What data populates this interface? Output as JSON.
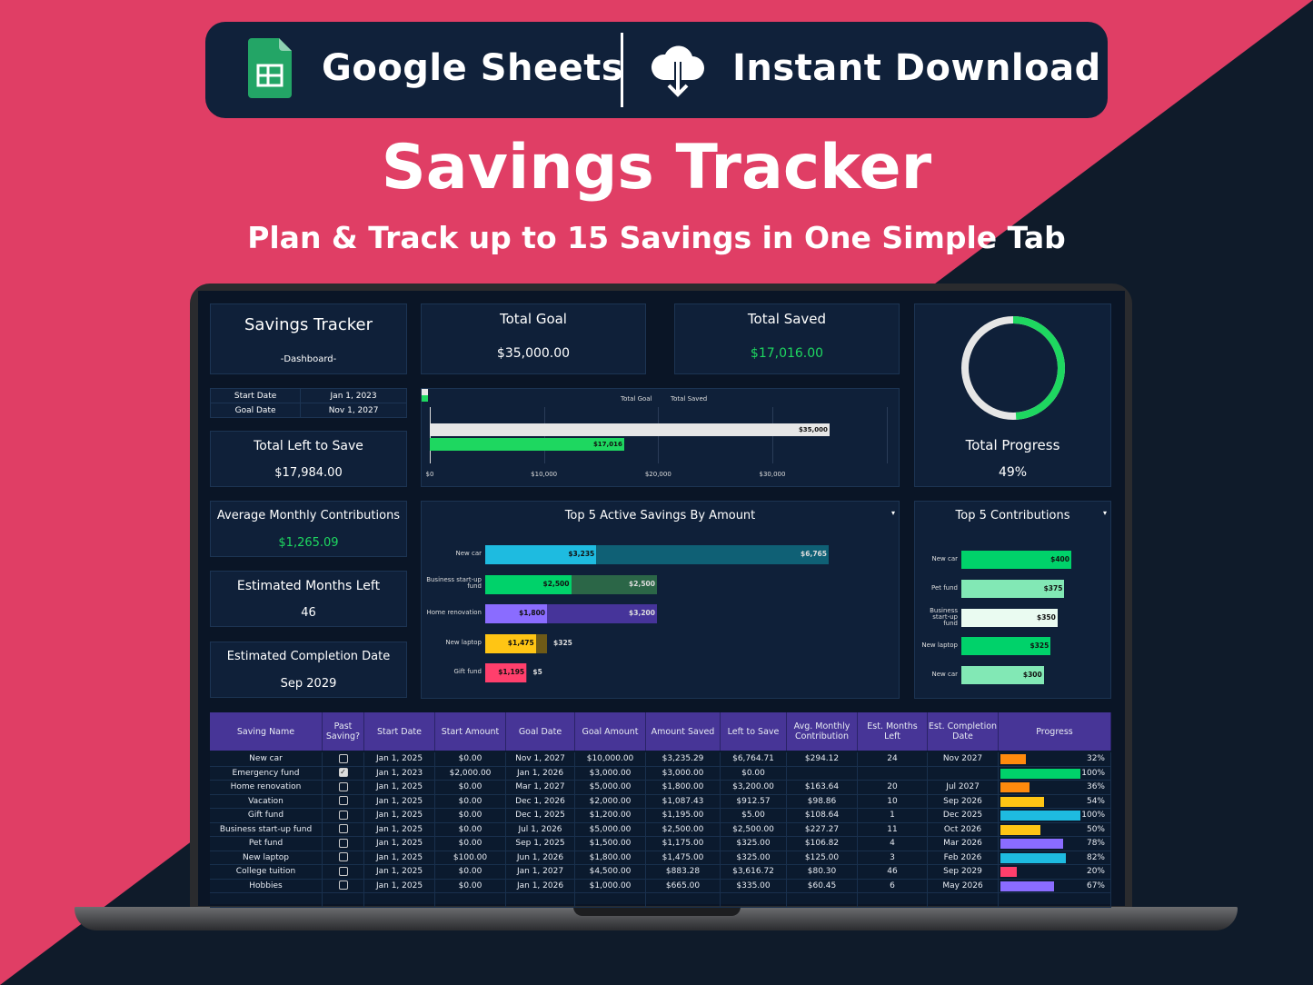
{
  "banner": {
    "app": "Google Sheets",
    "download": "Instant Download",
    "title": "Savings Tracker",
    "subtitle": "Plan & Track up to 15 Savings in One Simple Tab"
  },
  "colors": {
    "pink": "#e03e65",
    "navy": "#0f1b2a",
    "panel": "#0f2039",
    "header": "#473597",
    "green": "#1ed760"
  },
  "dashboard": {
    "title": "Savings Tracker",
    "subtitle": "-Dashboard-",
    "total_goal_label": "Total Goal",
    "total_goal": "$35,000.00",
    "total_saved_label": "Total Saved",
    "total_saved": "$17,016.00",
    "total_progress_label": "Total Progress",
    "total_progress": "49%",
    "progress_value": 0.49,
    "start_date_label": "Start Date",
    "start_date": "Jan 1, 2023",
    "goal_date_label": "Goal Date",
    "goal_date": "Nov 1, 2027",
    "left_label": "Total Left to Save",
    "left": "$17,984.00",
    "avg_label": "Average Monthly Contributions",
    "avg": "$1,265.09",
    "months_label": "Estimated Months Left",
    "months": "46",
    "completion_label": "Estimated Completion Date",
    "completion": "Sep 2029"
  },
  "chart_data": [
    {
      "type": "bar",
      "orientation": "horizontal",
      "legend": [
        "Total Goal",
        "Total Saved"
      ],
      "legend_position": "top",
      "series": [
        {
          "name": "Total Goal",
          "value": 35000,
          "label": "$35,000",
          "color": "#e6e6e6"
        },
        {
          "name": "Total Saved",
          "value": 17016,
          "label": "$17,016",
          "color": "#1ed760"
        }
      ],
      "x_ticks": [
        "$0",
        "$10,000",
        "$20,000",
        "$30,000"
      ],
      "xlim": [
        0,
        40000
      ]
    },
    {
      "type": "bar",
      "stacked": true,
      "orientation": "horizontal",
      "title": "Top 5 Active Savings By Amount",
      "categories": [
        "New car",
        "Business start-up fund",
        "Home renovation",
        "New laptop",
        "Gift fund"
      ],
      "saved": [
        3235,
        2500,
        1800,
        1475,
        1195
      ],
      "left": [
        6765,
        2500,
        3200,
        325,
        5
      ],
      "saved_labels": [
        "$3,235",
        "$2,500",
        "$1,800",
        "$1,475",
        "$1,195"
      ],
      "left_labels": [
        "$6,765",
        "$2,500",
        "$3,200",
        "$325",
        "$5"
      ],
      "colors": [
        "#1ebbe0",
        "#00d26a",
        "#8a6cff",
        "#ffc514",
        "#ff3f6c"
      ],
      "left_colors": [
        "#0f6075",
        "#2b6647",
        "#46349a",
        "#6e5a17",
        "#ff3f6c"
      ]
    },
    {
      "type": "bar",
      "orientation": "horizontal",
      "title": "Top 5 Contributions",
      "categories": [
        "New car",
        "Pet fund",
        "Business start-up fund",
        "New laptop",
        "New car"
      ],
      "values": [
        400,
        375,
        350,
        325,
        300
      ],
      "labels": [
        "$400",
        "$375",
        "$350",
        "$325",
        "$300"
      ],
      "colors": [
        "#00d26a",
        "#82e8b5",
        "#eafbf1",
        "#00d26a",
        "#82e8b5"
      ]
    }
  ],
  "table": {
    "headers": [
      "Saving Name",
      "Past Saving?",
      "Start Date",
      "Start Amount",
      "Goal Date",
      "Goal Amount",
      "Amount Saved",
      "Left to Save",
      "Avg. Monthly Contribution",
      "Est. Months Left",
      "Est. Completion Date",
      "Progress"
    ],
    "rows": [
      [
        "New car",
        false,
        "Jan 1, 2025",
        "$0.00",
        "Nov 1, 2027",
        "$10,000.00",
        "$3,235.29",
        "$6,764.71",
        "$294.12",
        "24",
        "Nov 2027",
        "32%",
        0.32,
        "#ff8a0d"
      ],
      [
        "Emergency fund",
        true,
        "Jan 1, 2023",
        "$2,000.00",
        "Jan 1, 2026",
        "$3,000.00",
        "$3,000.00",
        "$0.00",
        "",
        "",
        "",
        "100%",
        1,
        "#00d26a"
      ],
      [
        "Home renovation",
        false,
        "Jan 1, 2025",
        "$0.00",
        "Mar 1, 2027",
        "$5,000.00",
        "$1,800.00",
        "$3,200.00",
        "$163.64",
        "20",
        "Jul 2027",
        "36%",
        0.36,
        "#ff8a0d"
      ],
      [
        "Vacation",
        false,
        "Jan 1, 2025",
        "$0.00",
        "Dec 1, 2026",
        "$2,000.00",
        "$1,087.43",
        "$912.57",
        "$98.86",
        "10",
        "Sep 2026",
        "54%",
        0.54,
        "#ffc514"
      ],
      [
        "Gift fund",
        false,
        "Jan 1, 2025",
        "$0.00",
        "Dec 1, 2025",
        "$1,200.00",
        "$1,195.00",
        "$5.00",
        "$108.64",
        "1",
        "Dec 2025",
        "100%",
        1,
        "#1ebbe0"
      ],
      [
        "Business start-up fund",
        false,
        "Jan 1, 2025",
        "$0.00",
        "Jul 1, 2026",
        "$5,000.00",
        "$2,500.00",
        "$2,500.00",
        "$227.27",
        "11",
        "Oct 2026",
        "50%",
        0.5,
        "#ffc514"
      ],
      [
        "Pet fund",
        false,
        "Jan 1, 2025",
        "$0.00",
        "Sep 1, 2025",
        "$1,500.00",
        "$1,175.00",
        "$325.00",
        "$106.82",
        "4",
        "Mar 2026",
        "78%",
        0.78,
        "#8a6cff"
      ],
      [
        "New laptop",
        false,
        "Jan 1, 2025",
        "$100.00",
        "Jun 1, 2026",
        "$1,800.00",
        "$1,475.00",
        "$325.00",
        "$125.00",
        "3",
        "Feb 2026",
        "82%",
        0.82,
        "#1ebbe0"
      ],
      [
        "College tuition",
        false,
        "Jan 1, 2025",
        "$0.00",
        "Jan 1, 2027",
        "$4,500.00",
        "$883.28",
        "$3,616.72",
        "$80.30",
        "46",
        "Sep 2029",
        "20%",
        0.2,
        "#ff3f6c"
      ],
      [
        "Hobbies",
        false,
        "Jan 1, 2025",
        "$0.00",
        "Jan 1, 2026",
        "$1,000.00",
        "$665.00",
        "$335.00",
        "$60.45",
        "6",
        "May 2026",
        "67%",
        0.67,
        "#8a6cff"
      ]
    ]
  }
}
